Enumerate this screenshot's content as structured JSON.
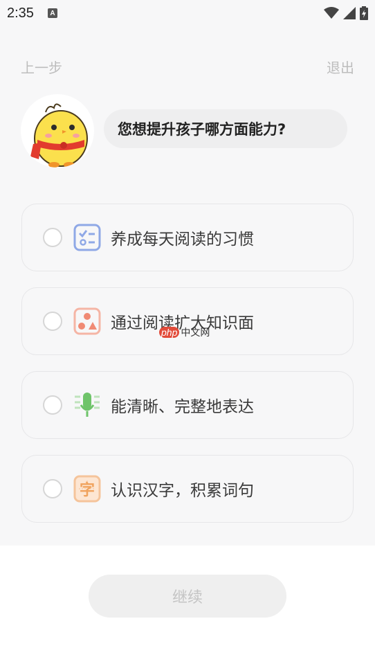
{
  "status_bar": {
    "time": "2:35",
    "keyboard_badge": "A"
  },
  "nav": {
    "back_label": "上一步",
    "exit_label": "退出"
  },
  "question": "您想提升孩子哪方面能力?",
  "options": [
    {
      "label": "养成每天阅读的习惯",
      "icon": "checklist-icon",
      "color": "#8fa8e6"
    },
    {
      "label": "通过阅读扩大知识面",
      "icon": "shapes-icon",
      "color": "#f08a74"
    },
    {
      "label": "能清晰、完整地表达",
      "icon": "microphone-icon",
      "color": "#6fc46a"
    },
    {
      "label": "认识汉字，积累词句",
      "icon": "character-icon",
      "color": "#f0a35e"
    }
  ],
  "continue_label": "继续",
  "watermark": {
    "brand": "php",
    "text": "中文网"
  }
}
